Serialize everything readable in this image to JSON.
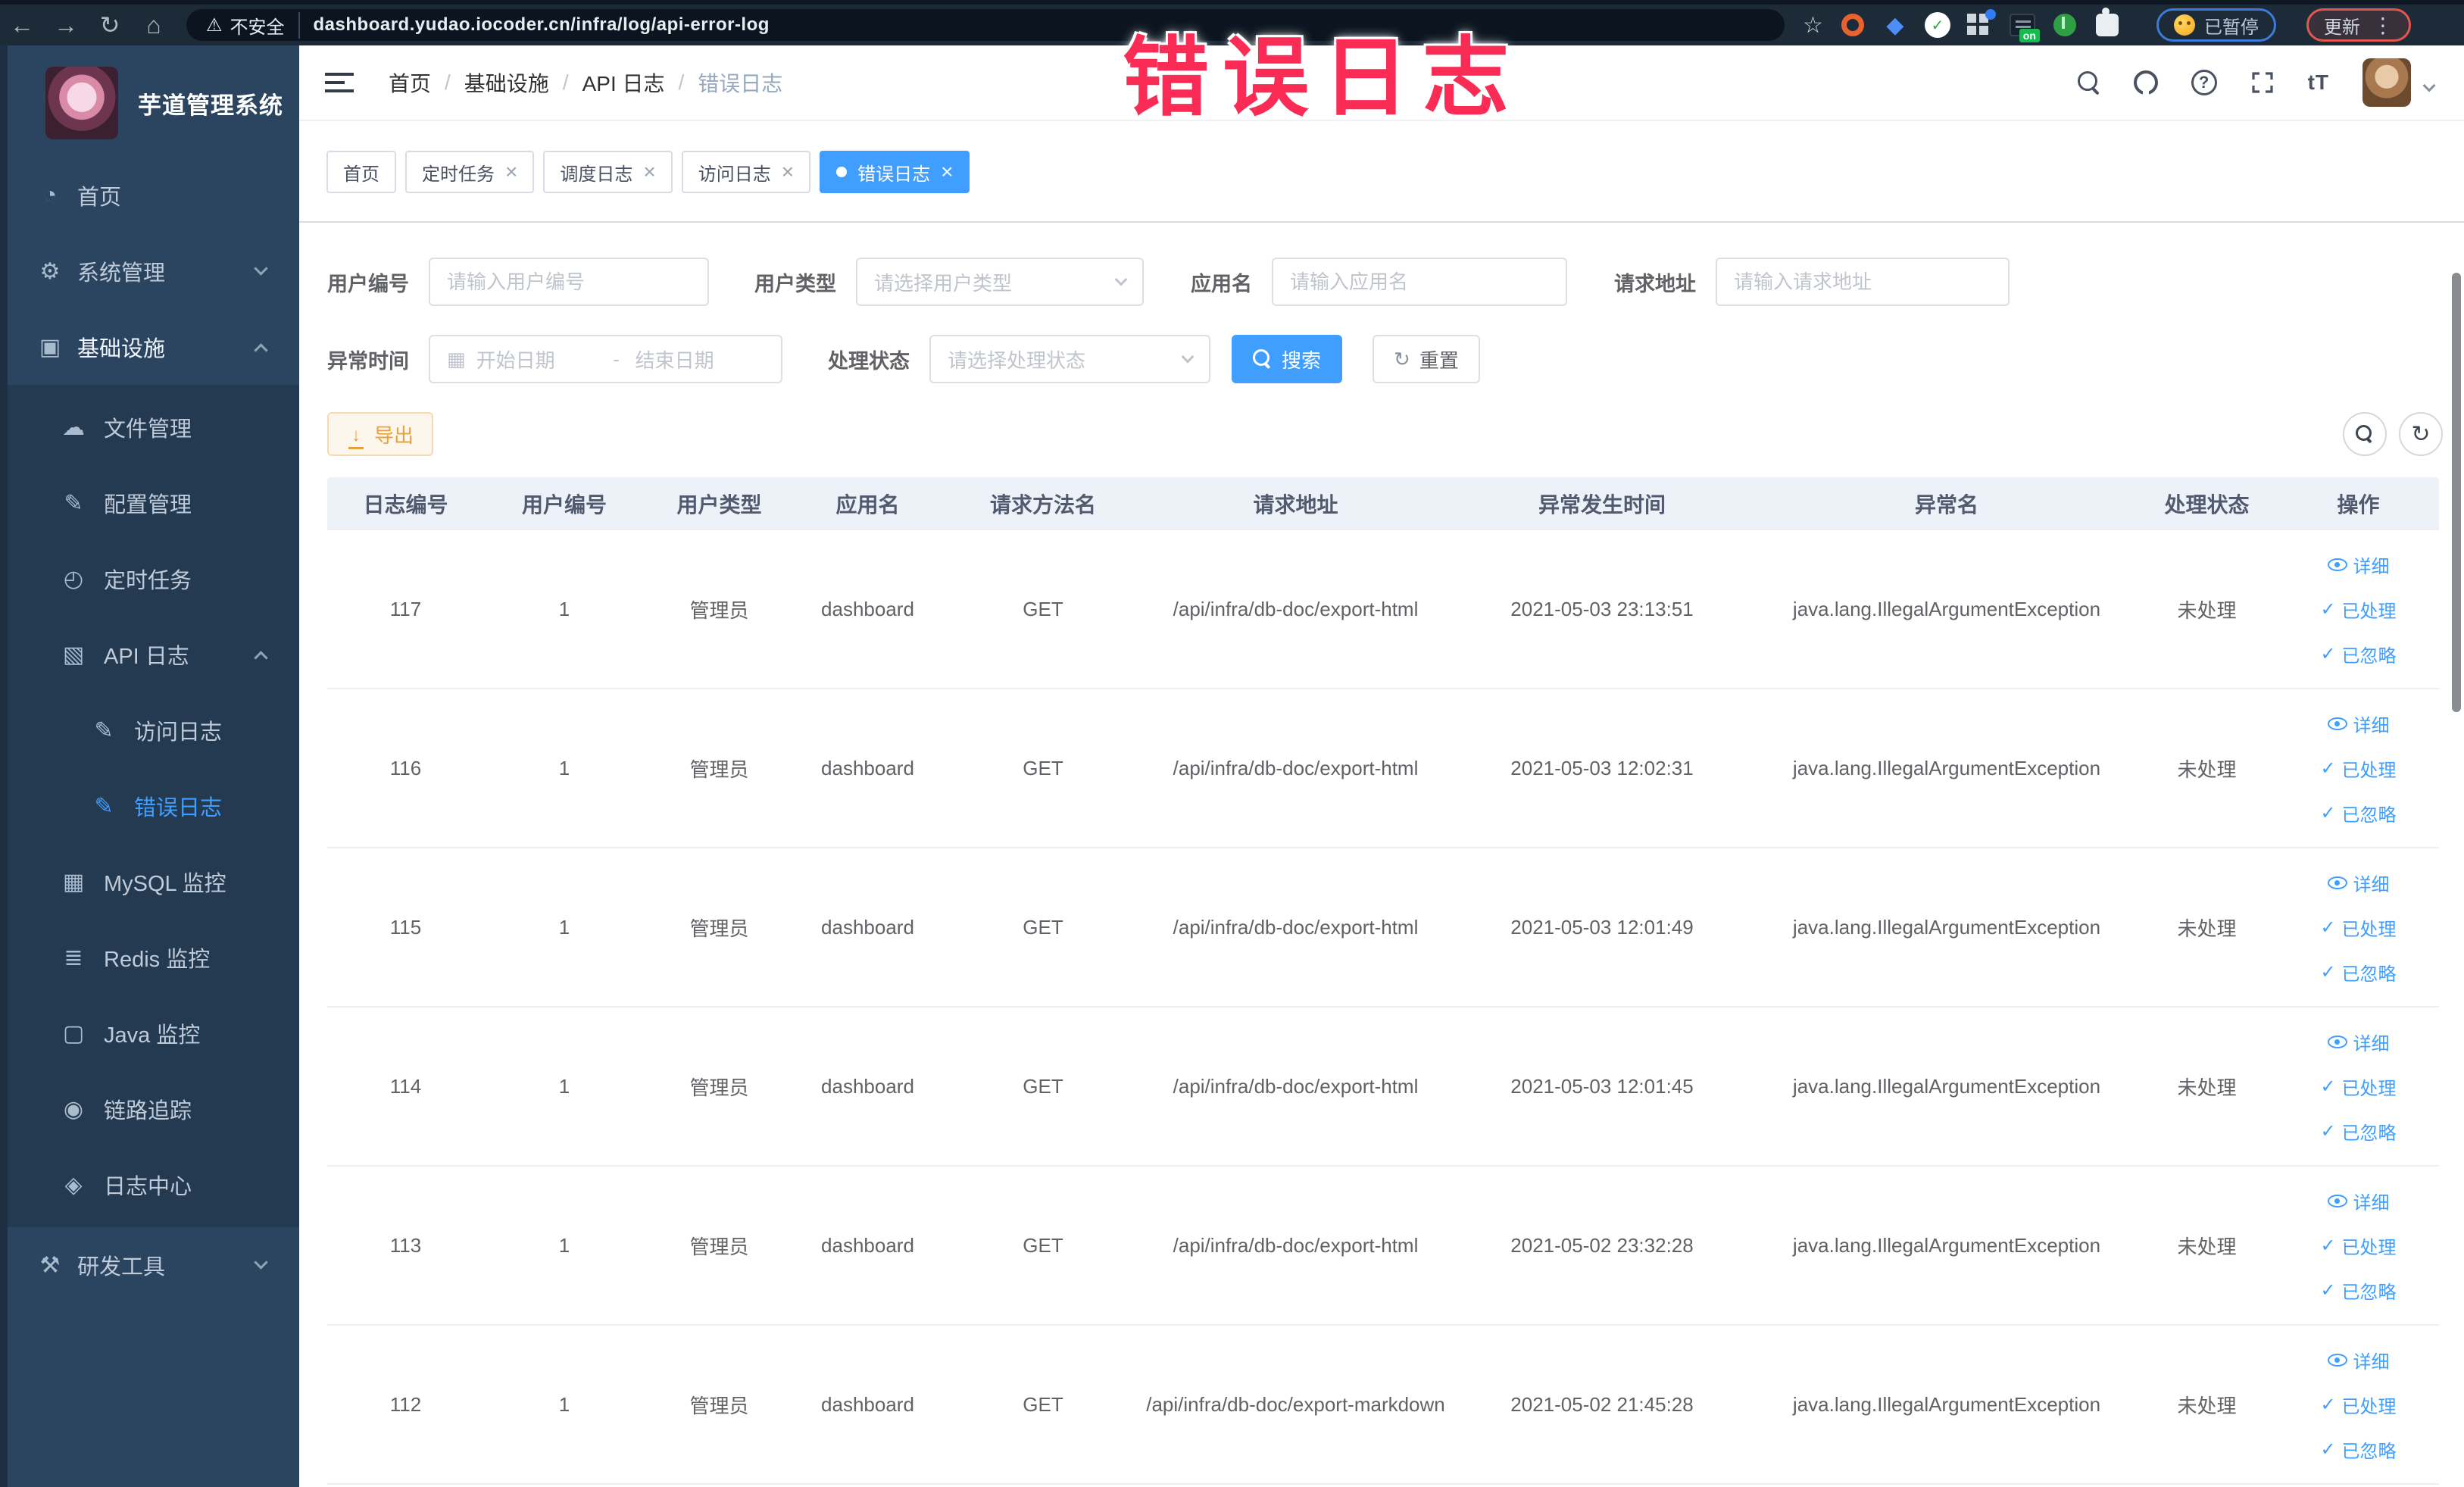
{
  "browser": {
    "security_label": "不安全",
    "url": "dashboard.yudao.iocoder.cn/infra/log/api-error-log",
    "on_badge": "on",
    "paused_pill": "已暂停",
    "update_button": "更新"
  },
  "annotation": {
    "text": "错误日志",
    "color": "#fa2c55"
  },
  "sidebar": {
    "title": "芋道管理系统",
    "items": {
      "home": "首页",
      "system": "系统管理",
      "infra": "基础设施",
      "file": "文件管理",
      "config": "配置管理",
      "job": "定时任务",
      "apilog": "API 日志",
      "accesslog": "访问日志",
      "errorlog": "错误日志",
      "mysql": "MySQL 监控",
      "redis": "Redis 监控",
      "java": "Java 监控",
      "trace": "链路追踪",
      "logcenter": "日志中心",
      "devtools": "研发工具"
    }
  },
  "header": {
    "breadcrumb": [
      "首页",
      "基础设施",
      "API 日志",
      "错误日志"
    ]
  },
  "tabs": [
    {
      "label": "首页"
    },
    {
      "label": "定时任务"
    },
    {
      "label": "调度日志"
    },
    {
      "label": "访问日志"
    },
    {
      "label": "错误日志"
    }
  ],
  "filters": {
    "user_id_label": "用户编号",
    "user_id_placeholder": "请输入用户编号",
    "user_type_label": "用户类型",
    "user_type_placeholder": "请选择用户类型",
    "app_name_label": "应用名",
    "app_name_placeholder": "请输入应用名",
    "request_url_label": "请求地址",
    "request_url_placeholder": "请输入请求地址",
    "exception_time_label": "异常时间",
    "date_start_placeholder": "开始日期",
    "date_separator": "-",
    "date_end_placeholder": "结束日期",
    "process_status_label": "处理状态",
    "process_status_placeholder": "请选择处理状态",
    "search_button": "搜索",
    "reset_button": "重置"
  },
  "toolbar": {
    "export_button": "导出"
  },
  "table": {
    "columns": [
      "日志编号",
      "用户编号",
      "用户类型",
      "应用名",
      "请求方法名",
      "请求地址",
      "异常发生时间",
      "异常名",
      "处理状态",
      "操作"
    ],
    "actions": {
      "detail": "详细",
      "processed": "已处理",
      "ignored": "已忽略"
    },
    "rows": [
      {
        "id": "117",
        "user_id": "1",
        "user_type": "管理员",
        "app": "dashboard",
        "method": "GET",
        "url": "/api/infra/db-doc/export-html",
        "time": "2021-05-03 23:13:51",
        "exception": "java.lang.IllegalArgumentException",
        "status": "未处理"
      },
      {
        "id": "116",
        "user_id": "1",
        "user_type": "管理员",
        "app": "dashboard",
        "method": "GET",
        "url": "/api/infra/db-doc/export-html",
        "time": "2021-05-03 12:02:31",
        "exception": "java.lang.IllegalArgumentException",
        "status": "未处理"
      },
      {
        "id": "115",
        "user_id": "1",
        "user_type": "管理员",
        "app": "dashboard",
        "method": "GET",
        "url": "/api/infra/db-doc/export-html",
        "time": "2021-05-03 12:01:49",
        "exception": "java.lang.IllegalArgumentException",
        "status": "未处理"
      },
      {
        "id": "114",
        "user_id": "1",
        "user_type": "管理员",
        "app": "dashboard",
        "method": "GET",
        "url": "/api/infra/db-doc/export-html",
        "time": "2021-05-03 12:01:45",
        "exception": "java.lang.IllegalArgumentException",
        "status": "未处理"
      },
      {
        "id": "113",
        "user_id": "1",
        "user_type": "管理员",
        "app": "dashboard",
        "method": "GET",
        "url": "/api/infra/db-doc/export-html",
        "time": "2021-05-02 23:32:28",
        "exception": "java.lang.IllegalArgumentException",
        "status": "未处理"
      },
      {
        "id": "112",
        "user_id": "1",
        "user_type": "管理员",
        "app": "dashboard",
        "method": "GET",
        "url": "/api/infra/db-doc/export-markdown",
        "time": "2021-05-02 21:45:28",
        "exception": "java.lang.IllegalArgumentException",
        "status": "未处理"
      }
    ]
  },
  "colors": {
    "primary": "#409eff",
    "warning": "#e6a23c",
    "sidebar": "#2b4560",
    "annotation": "#fa2c55"
  }
}
